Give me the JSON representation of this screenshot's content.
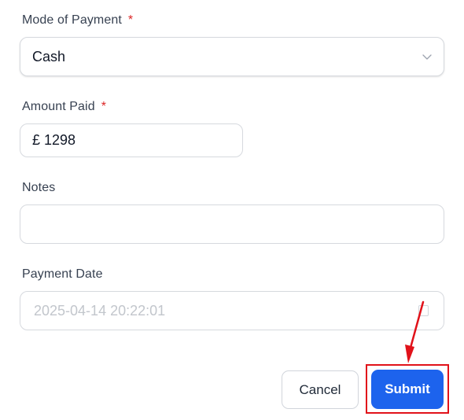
{
  "form": {
    "mode_of_payment": {
      "label": "Mode of Payment",
      "required_mark": "*",
      "value": "Cash"
    },
    "amount_paid": {
      "label": "Amount Paid",
      "required_mark": "*",
      "value": "£ 1298"
    },
    "notes": {
      "label": "Notes",
      "value": ""
    },
    "payment_date": {
      "label": "Payment Date",
      "value": "2025-04-14 20:22:01"
    }
  },
  "actions": {
    "cancel_label": "Cancel",
    "submit_label": "Submit"
  },
  "colors": {
    "primary": "#1d63ed",
    "required": "#dc2626",
    "annotation": "#e1121a"
  },
  "icons": {
    "select_chevron": "chevron-down-icon",
    "calendar": "calendar-icon",
    "annotation_arrow": "arrow-icon"
  }
}
